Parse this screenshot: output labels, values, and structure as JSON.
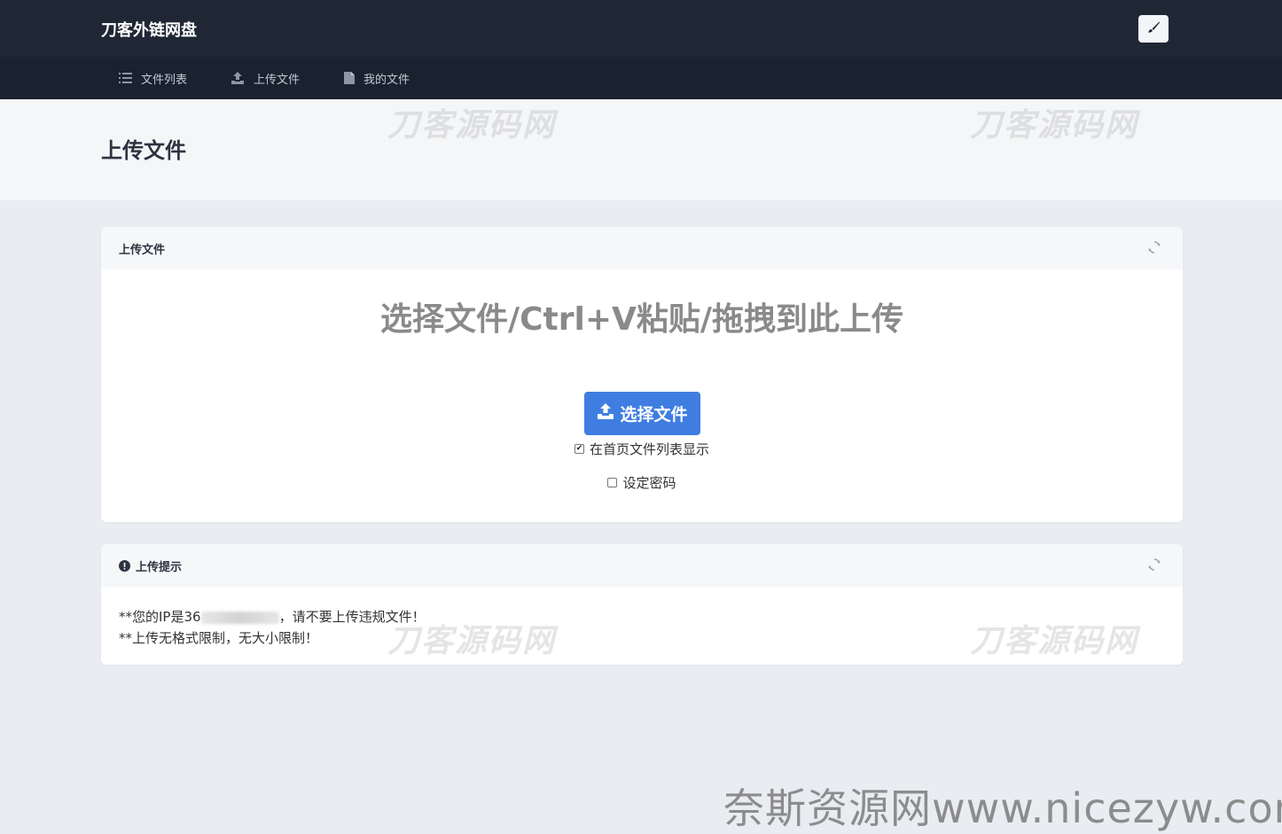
{
  "header": {
    "brand": "刀客外链网盘",
    "theme_icon": "brush-icon"
  },
  "nav": {
    "items": [
      {
        "label": "文件列表",
        "icon": "list-icon"
      },
      {
        "label": "上传文件",
        "icon": "upload-icon"
      },
      {
        "label": "我的文件",
        "icon": "file-icon"
      }
    ]
  },
  "page": {
    "title": "上传文件"
  },
  "upload_card": {
    "title": "上传文件",
    "prompt": "选择文件/Ctrl+V粘贴/拖拽到此上传",
    "button_label": "选择文件",
    "show_on_home": {
      "label": "在首页文件列表显示",
      "checked": true
    },
    "set_password": {
      "label": "设定密码",
      "checked": false
    }
  },
  "tips_card": {
    "title": "上传提示",
    "ip_prefix": "**您的IP是36",
    "ip_suffix": "，请不要上传违规文件！",
    "line2": "**上传无格式限制，无大小限制！"
  },
  "watermarks": {
    "brand": "刀客源码网",
    "site": "奈斯资源网www.nicezyw.com"
  },
  "colors": {
    "topbar": "#1f2735",
    "navbar": "#1a2230",
    "accent": "#3f7ee0",
    "background": "#e9ecf1"
  }
}
